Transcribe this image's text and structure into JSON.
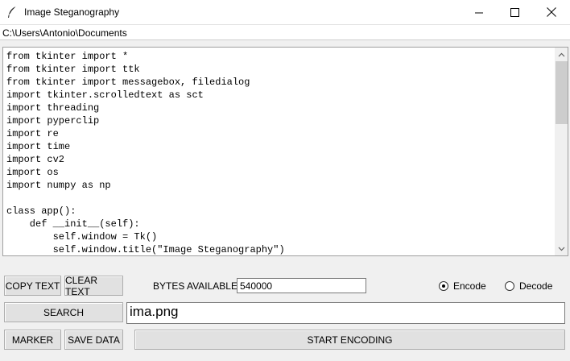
{
  "window": {
    "title": "Image Steganography"
  },
  "path_bar": {
    "path": "C:\\Users\\Antonio\\Documents"
  },
  "editor": {
    "code": "from tkinter import *\nfrom tkinter import ttk\nfrom tkinter import messagebox, filedialog\nimport tkinter.scrolledtext as sct\nimport threading\nimport pyperclip\nimport re\nimport time\nimport cv2\nimport os\nimport numpy as np\n\nclass app():\n    def __init__(self):\n        self.window = Tk()\n        self.window.title(\"Image Steganography\")"
  },
  "toolbar": {
    "copy_text": "COPY TEXT",
    "clear_text": "CLEAR TEXT",
    "bytes_label": "BYTES AVAILABLE:",
    "bytes_value": "540000",
    "encode_label": "Encode",
    "decode_label": "Decode",
    "selected_mode": "Encode"
  },
  "search_row": {
    "search_label": "SEARCH",
    "file_value": "ima.png"
  },
  "action_row": {
    "marker_label": "MARKER",
    "save_label": "SAVE DATA",
    "start_label": "START ENCODING"
  },
  "icons": {
    "app": "feather-icon",
    "minimize": "minimize-icon",
    "maximize": "maximize-icon",
    "close": "close-icon"
  }
}
